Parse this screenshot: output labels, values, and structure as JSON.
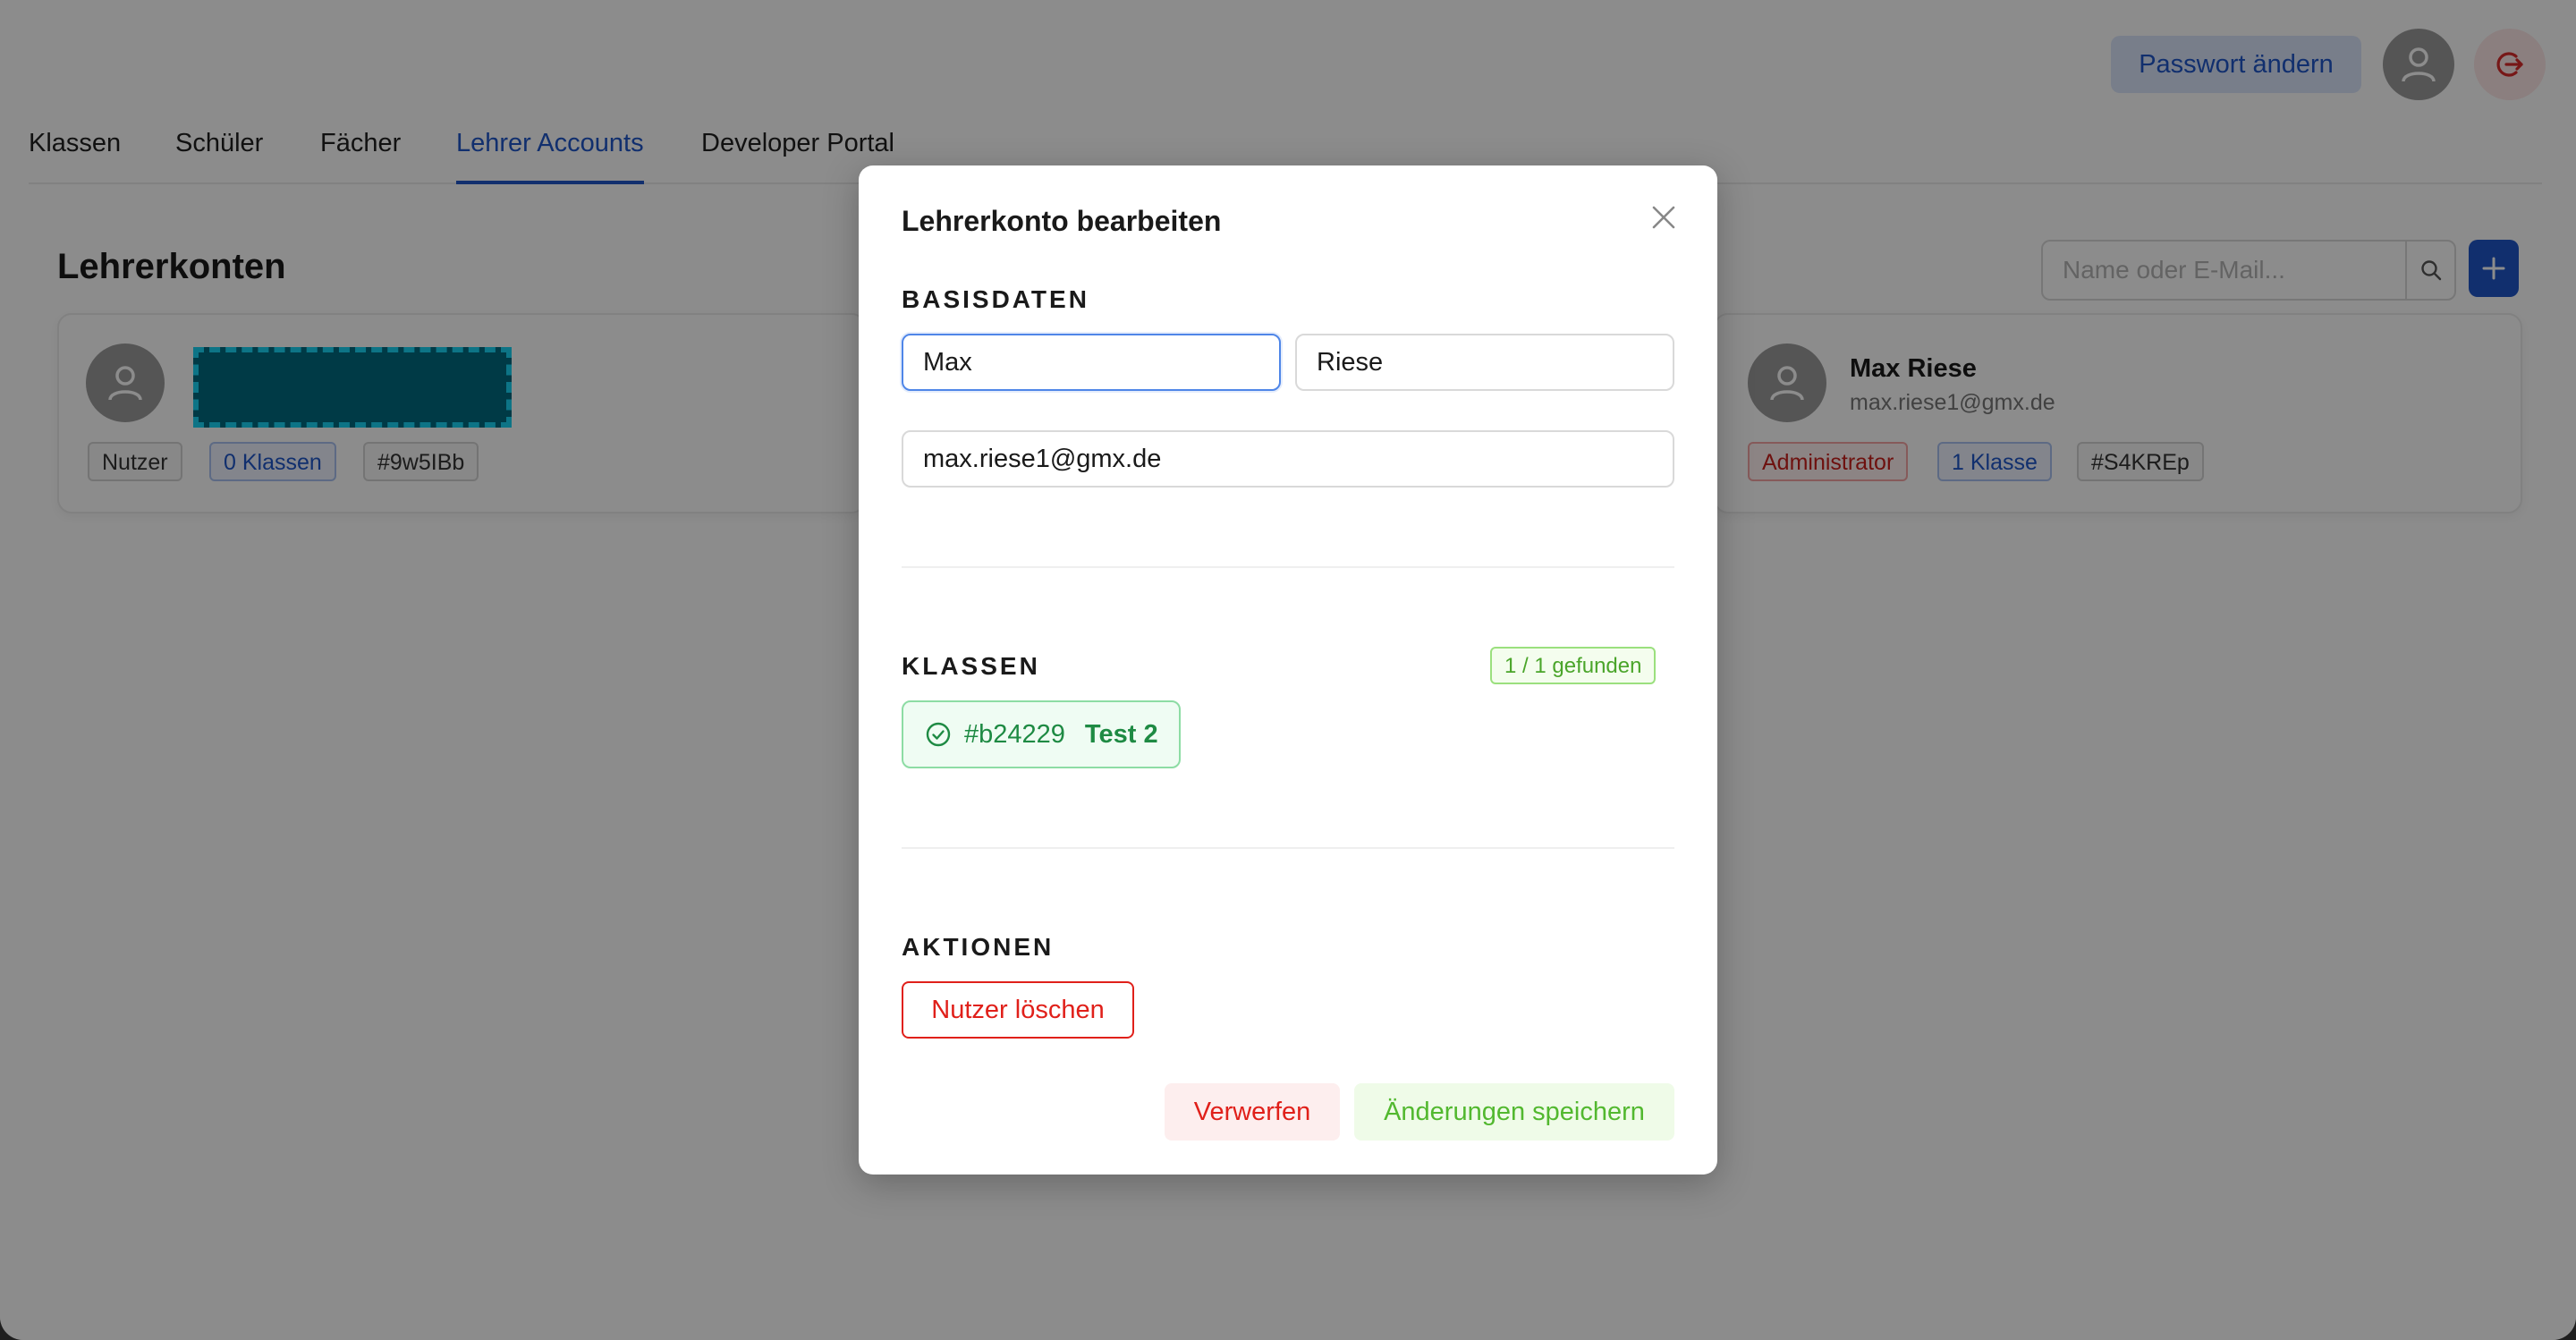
{
  "header": {
    "change_password_label": "Passwort ändern"
  },
  "tabs": [
    {
      "label": "Klassen"
    },
    {
      "label": "Schüler"
    },
    {
      "label": "Fächer"
    },
    {
      "label": "Lehrer Accounts",
      "active": true
    },
    {
      "label": "Developer Portal"
    }
  ],
  "page": {
    "title": "Lehrerkonten",
    "search_placeholder": "Name oder E-Mail..."
  },
  "cards": [
    {
      "name": "",
      "email": "",
      "name_redacted": true,
      "tags": [
        "Nutzer",
        "0 Klassen",
        "#9w5IBb"
      ]
    },
    {
      "name": "Max Riese",
      "email": "max.riese1@gmx.de",
      "tags": [
        "Administrator",
        "1 Klasse",
        "#S4KREp"
      ]
    }
  ],
  "modal": {
    "title": "Lehrerkonto bearbeiten",
    "basisdaten_label": "BASISDATEN",
    "first_name": "Max",
    "last_name": "Riese",
    "email": "max.riese1@gmx.de",
    "klassen_label": "KLASSEN",
    "found_label": "1 / 1 gefunden",
    "classes": [
      {
        "id": "#b24229",
        "name": "Test 2"
      }
    ],
    "aktionen_label": "AKTIONEN",
    "delete_label": "Nutzer löschen",
    "discard_label": "Verwerfen",
    "save_label": "Änderungen speichern"
  },
  "colors": {
    "accent": "#1f57c8",
    "danger": "#e0201a",
    "success": "#52b82f",
    "redaction": "#006b80"
  }
}
